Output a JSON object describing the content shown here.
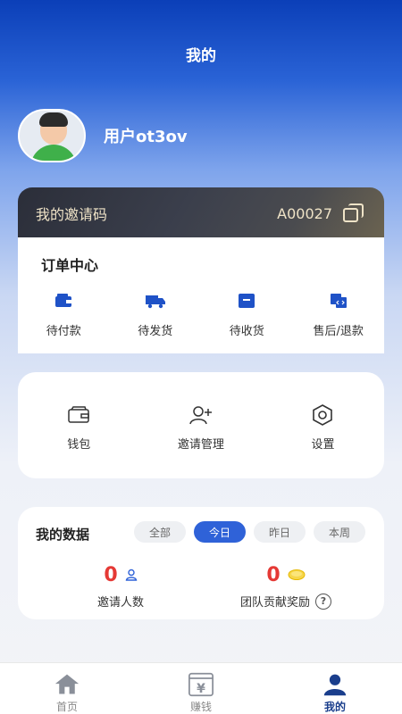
{
  "header": {
    "title": "我的"
  },
  "profile": {
    "username": "用户ot3ov"
  },
  "invite": {
    "label": "我的邀请码",
    "code": "A00027"
  },
  "orders": {
    "title": "订单中心",
    "items": [
      {
        "label": "待付款",
        "icon": "wallet-icon"
      },
      {
        "label": "待发货",
        "icon": "truck-icon"
      },
      {
        "label": "待收货",
        "icon": "box-icon"
      },
      {
        "label": "售后/退款",
        "icon": "exchange-icon"
      }
    ]
  },
  "tools": {
    "items": [
      {
        "label": "钱包",
        "icon": "wallet-outline-icon"
      },
      {
        "label": "邀请管理",
        "icon": "add-user-icon"
      },
      {
        "label": "设置",
        "icon": "gear-icon"
      }
    ]
  },
  "data": {
    "title": "我的数据",
    "filters": [
      "全部",
      "今日",
      "昨日",
      "本周"
    ],
    "active_filter": "今日",
    "stats": [
      {
        "value": "0",
        "label": "邀请人数"
      },
      {
        "value": "0",
        "label": "团队贡献奖励"
      }
    ]
  },
  "nav": {
    "items": [
      {
        "label": "首页"
      },
      {
        "label": "赚钱"
      },
      {
        "label": "我的"
      }
    ],
    "active": "我的"
  },
  "colors": {
    "primary": "#2f62d8",
    "accent_red": "#e53935",
    "gold": "#efe3c7"
  }
}
